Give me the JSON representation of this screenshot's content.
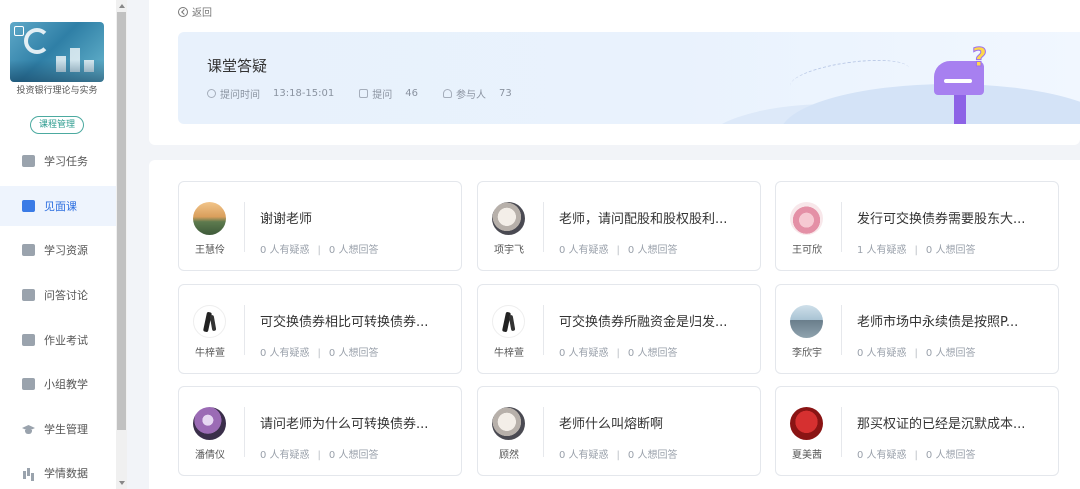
{
  "sidebar": {
    "course_title": "投资银行理论与实务",
    "course_manage_label": "课程管理",
    "items": [
      {
        "label": "学习任务",
        "icon": "task-icon"
      },
      {
        "label": "见面课",
        "icon": "person-icon",
        "active": true
      },
      {
        "label": "学习资源",
        "icon": "resource-icon"
      },
      {
        "label": "问答讨论",
        "icon": "discussion-icon"
      },
      {
        "label": "作业考试",
        "icon": "exam-icon"
      },
      {
        "label": "小组教学",
        "icon": "group-icon"
      },
      {
        "label": "学生管理",
        "icon": "graduation-cap-icon"
      },
      {
        "label": "学情数据",
        "icon": "bar-chart-icon"
      }
    ]
  },
  "header": {
    "back_label": "返回",
    "title": "课堂答疑",
    "time_label": "提问时间",
    "time_value": "13:18-15:01",
    "questions_label": "提问",
    "questions_value": "46",
    "participants_label": "参与人",
    "participants_value": "73"
  },
  "questions": [
    {
      "name": "王慧伶",
      "text": "谢谢老师",
      "doubt": "0 人有疑惑",
      "answer": "0 人想回答"
    },
    {
      "name": "项宇飞",
      "text": "老师，请问配股和股权股利...",
      "doubt": "0 人有疑惑",
      "answer": "0 人想回答"
    },
    {
      "name": "王可欣",
      "text": "发行可交换债券需要股东大...",
      "doubt": "1 人有疑惑",
      "answer": "0 人想回答"
    },
    {
      "name": "牛梓萱",
      "text": "可交换债券相比可转换债券...",
      "doubt": "0 人有疑惑",
      "answer": "0 人想回答"
    },
    {
      "name": "牛梓萱",
      "text": "可交换债券所融资金是归发...",
      "doubt": "0 人有疑惑",
      "answer": "0 人想回答"
    },
    {
      "name": "李欣宇",
      "text": "老师市场中永续债是按照P...",
      "doubt": "0 人有疑惑",
      "answer": "0 人想回答"
    },
    {
      "name": "潘倩仪",
      "text": "请问老师为什么可转换债券...",
      "doubt": "0 人有疑惑",
      "answer": "0 人想回答"
    },
    {
      "name": "顾然",
      "text": "老师什么叫熔断啊",
      "doubt": "0 人有疑惑",
      "answer": "0 人想回答"
    },
    {
      "name": "夏美茜",
      "text": "那买权证的已经是沉默成本...",
      "doubt": "0 人有疑惑",
      "answer": "0 人想回答"
    }
  ],
  "colors": {
    "accent": "#2d6fe0",
    "course_manage": "#2e9c8f",
    "mailbox": "#a780f0"
  }
}
